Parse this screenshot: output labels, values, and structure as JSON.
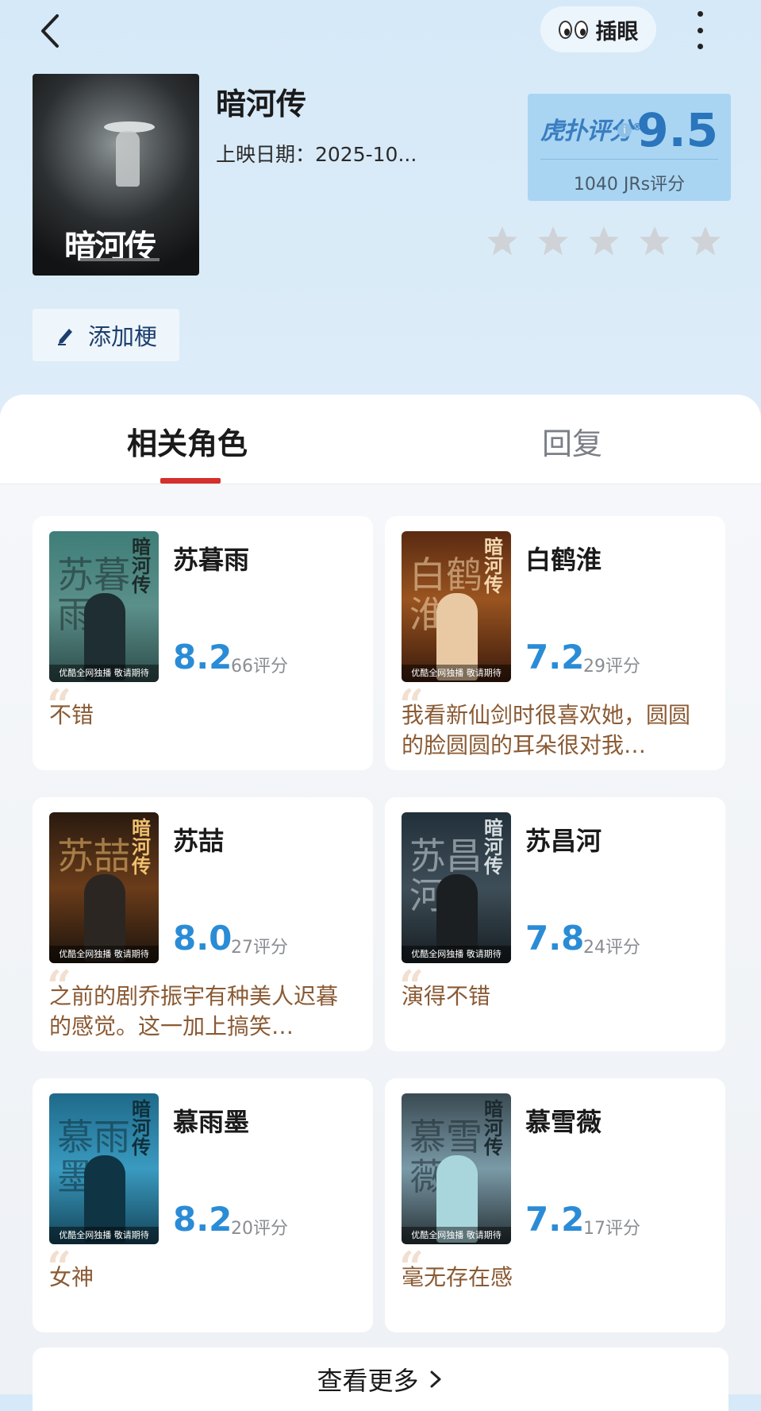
{
  "header": {
    "chajian_label": "插眼"
  },
  "show": {
    "title": "暗河传",
    "release": "上映日期：2025-10...",
    "poster_title": "暗河传"
  },
  "rating": {
    "brand": "虎扑评分",
    "score": "9.5",
    "count": "1040 JRs评分",
    "user_stars": 0,
    "star_color": "#cfd3d8"
  },
  "actions": {
    "add_meme": "添加梗"
  },
  "tabs": [
    {
      "label": "相关角色",
      "active": true
    },
    {
      "label": "回复",
      "active": false
    }
  ],
  "characters": [
    {
      "name": "苏暮雨",
      "score": "8.2",
      "count": "66评分",
      "comment": "不错",
      "poster_big": "苏暮雨"
    },
    {
      "name": "白鹤淮",
      "score": "7.2",
      "count": "29评分",
      "comment": "我看新仙剑时很喜欢她，圆圆的脸圆圆的耳朵很对我…",
      "poster_big": "白鹤淮"
    },
    {
      "name": "苏喆",
      "score": "8.0",
      "count": "27评分",
      "comment": "之前的剧乔振宇有种美人迟暮的感觉。这一加上搞笑…",
      "poster_big": "苏喆"
    },
    {
      "name": "苏昌河",
      "score": "7.8",
      "count": "24评分",
      "comment": "演得不错",
      "poster_big": "苏昌河"
    },
    {
      "name": "慕雨墨",
      "score": "8.2",
      "count": "20评分",
      "comment": "女神",
      "poster_big": "慕雨墨"
    },
    {
      "name": "慕雪薇",
      "score": "7.2",
      "count": "17评分",
      "comment": "毫无存在感",
      "poster_big": "慕雪薇"
    }
  ],
  "poster_band_text": "优酷全网独播 敬请期待",
  "view_more": "查看更多",
  "colors": {
    "accent_blue": "#2a8cd6",
    "tab_underline": "#d4302e",
    "comment_brown": "#8a5a33"
  }
}
